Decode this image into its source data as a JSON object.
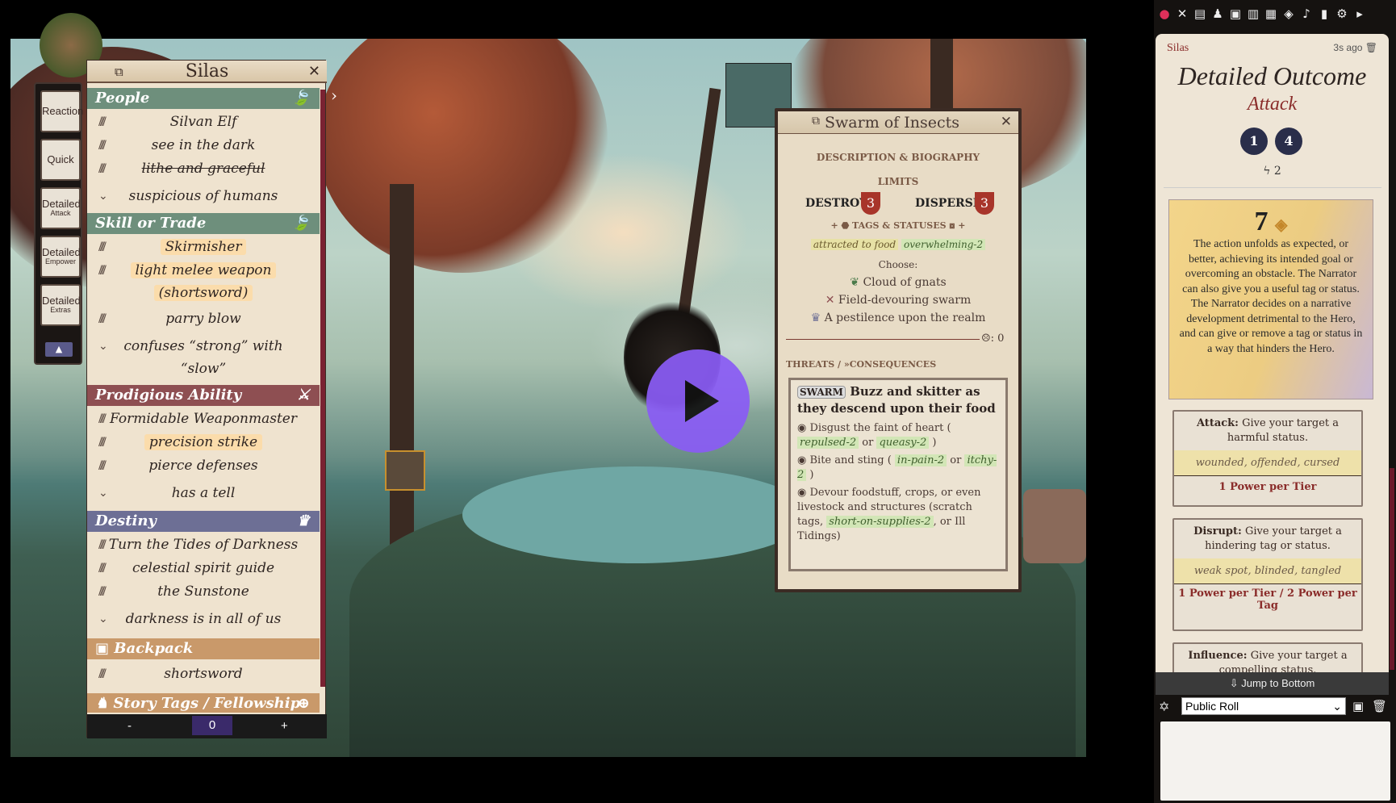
{
  "character": {
    "name": "Silas"
  },
  "hud": {
    "buttons": [
      {
        "label": "Reaction"
      },
      {
        "label": "Quick"
      },
      {
        "label": "Detailed",
        "sub": "Attack"
      },
      {
        "label": "Detailed",
        "sub": "Empower"
      },
      {
        "label": "Detailed",
        "sub": "Extras"
      }
    ]
  },
  "sheet": {
    "sections": [
      {
        "title": "People",
        "color": "#6e8f7c",
        "items": [
          "Silvan Elf",
          "see in the dark",
          "lithe and graceful",
          "suspicious of humans"
        ]
      },
      {
        "title": "Skill or Trade",
        "color": "#6e8f7c",
        "items": [
          "Skirmisher",
          "light melee weapon",
          "(shortsword)",
          "parry blow",
          "confuses “strong” with",
          "“slow”"
        ]
      },
      {
        "title": "Prodigious Ability",
        "color": "#8e4f52",
        "items": [
          "Formidable Weaponmaster",
          "precision strike",
          "pierce defenses",
          "has a tell"
        ]
      },
      {
        "title": "Destiny",
        "color": "#6d6f95",
        "items": [
          "Turn the Tides of Darkness",
          "celestial spirit guide",
          "the Sunstone",
          "darkness is in all of us"
        ]
      },
      {
        "title": "Backpack",
        "color": "#c9996a",
        "items": [
          "shortsword"
        ]
      },
      {
        "title": "Story Tags / Fellowship",
        "color": "#c9996a",
        "items": []
      }
    ],
    "counter": {
      "minus": "-",
      "value": "0",
      "plus": "+"
    }
  },
  "swarm": {
    "title": "Swarm of Insects",
    "desc_header": "DESCRIPTION & BIOGRAPHY",
    "limits_header": "LIMITS",
    "destroy_label": "DESTROY:",
    "destroy_value": "3",
    "disperse_label": "DISPERSE:",
    "disperse_value": "3",
    "tags_header": "TAGS & STATUSES",
    "tags": [
      "attracted to food",
      "overwhelming-2"
    ],
    "choose": "Choose:",
    "options": [
      "Cloud of gnats",
      "Field-devouring swarm",
      "A pestilence upon the realm"
    ],
    "counter": ": 0",
    "threats_header": "THREATS / »CONSEQUENCES",
    "threat_name": "SWARM",
    "threat_text": "Buzz and skitter as they descend upon their food",
    "consequences": [
      {
        "text": "Disgust the faint of heart (",
        "tags": [
          "repulsed-2",
          "queasy-2"
        ],
        "joiner": "or",
        "end": ")"
      },
      {
        "text": "Bite and sting (",
        "tags": [
          "in-pain-2",
          "itchy-2"
        ],
        "joiner": "or",
        "end": ")"
      },
      {
        "text": "Devour foodstuff, crops, or even livestock and structures (scratch tags,",
        "tags": [
          "short-on-supplies-2"
        ],
        "end": ", or Ill Tidings)"
      }
    ]
  },
  "chat": {
    "speaker": "Silas",
    "time": "3s ago",
    "title": "Detailed Outcome",
    "subtitle": "Attack",
    "dice": [
      "1",
      "4"
    ],
    "power": "2",
    "result": "7",
    "result_text": "The action unfolds as expected, or better, achieving its intended goal or overcoming an obstacle. The Narrator can also give you a useful tag or status. The Narrator decides on a narrative development detrimental to the Hero, and can give or remove a tag or status in a way that hinders the Hero.",
    "effects": [
      {
        "name": "Attack:",
        "desc": "Give your target a harmful status.",
        "examples": "wounded, offended, cursed",
        "cost": "1 Power per Tier"
      },
      {
        "name": "Disrupt:",
        "desc": "Give your target a hindering tag or status.",
        "examples": "weak spot, blinded, tangled",
        "cost": "1 Power per Tier / 2 Power per Tag"
      },
      {
        "name": "Influence:",
        "desc": "Give your target a compelling status."
      }
    ],
    "jump": "Jump to Bottom",
    "roll_mode": "Public Roll"
  },
  "colors": {
    "accent": "#8a5cf5",
    "brand": "#8a2c2a"
  }
}
